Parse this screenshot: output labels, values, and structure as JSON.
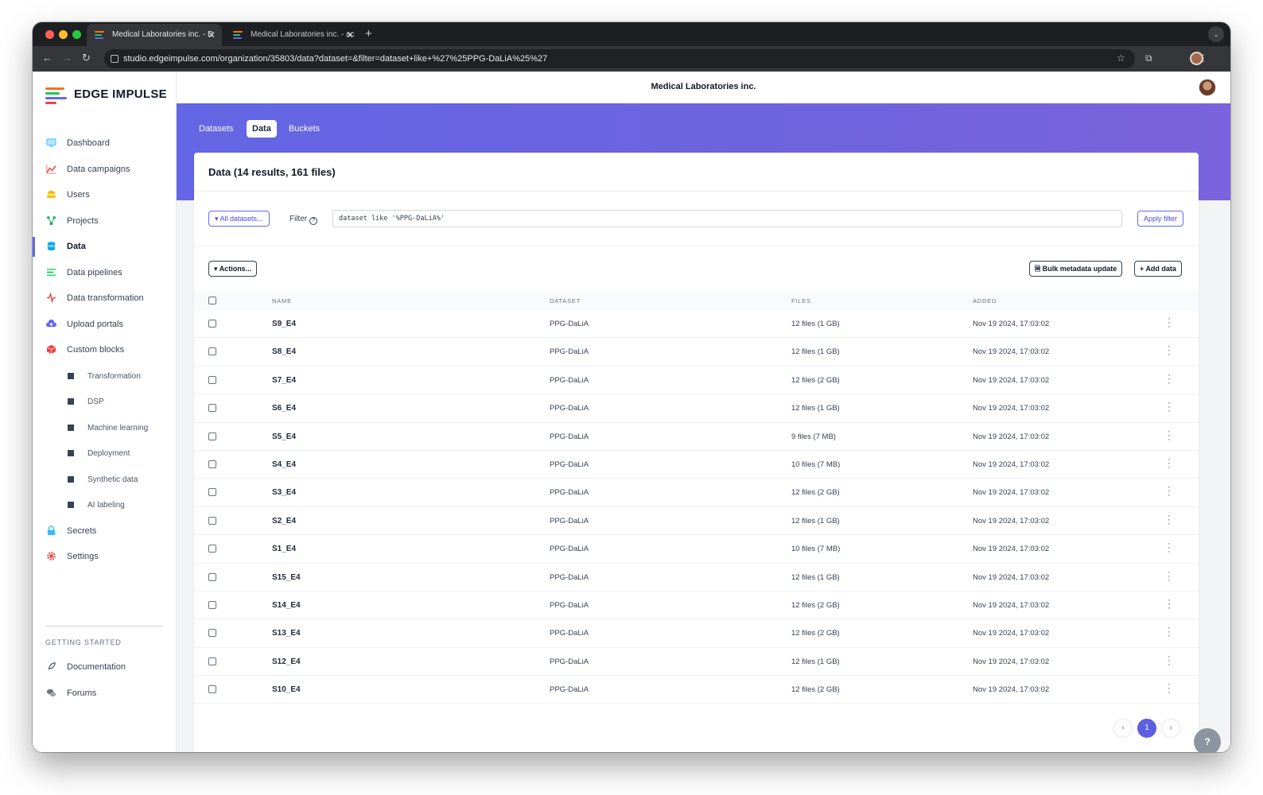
{
  "browser": {
    "tabs": [
      {
        "title": "Medical Laboratories inc. - D",
        "active": true
      },
      {
        "title": "Medical Laboratories inc. - ac",
        "active": false
      }
    ],
    "url": "studio.edgeimpulse.com/organization/35803/data?dataset=&filter=dataset+like+%27%25PPG-DaLiA%25%27"
  },
  "logo": {
    "text": "EDGE IMPULSE"
  },
  "sidebar": {
    "items": [
      {
        "label": "Dashboard",
        "icon": "monitor-icon"
      },
      {
        "label": "Data campaigns",
        "icon": "chart-line-icon"
      },
      {
        "label": "Users",
        "icon": "users-icon"
      },
      {
        "label": "Projects",
        "icon": "project-tree-icon"
      },
      {
        "label": "Data",
        "icon": "database-icon",
        "active": true
      },
      {
        "label": "Data pipelines",
        "icon": "list-icon"
      },
      {
        "label": "Data transformation",
        "icon": "pulse-icon"
      },
      {
        "label": "Upload portals",
        "icon": "cloud-upload-icon"
      },
      {
        "label": "Custom blocks",
        "icon": "cube-icon"
      }
    ],
    "sub_items": [
      "Transformation",
      "DSP",
      "Machine learning",
      "Deployment",
      "Synthetic data",
      "AI labeling"
    ],
    "bottom_items": [
      {
        "label": "Secrets",
        "icon": "lock-icon"
      },
      {
        "label": "Settings",
        "icon": "gear-icon"
      }
    ],
    "getting_started": {
      "heading": "GETTING STARTED",
      "items": [
        {
          "label": "Documentation",
          "icon": "rocket-icon"
        },
        {
          "label": "Forums",
          "icon": "chat-icon"
        }
      ]
    }
  },
  "header": {
    "org_title": "Medical Laboratories inc."
  },
  "subtabs": [
    "Datasets",
    "Data",
    "Buckets"
  ],
  "card": {
    "title": "Data (14 results, 161 files)",
    "all_datasets_label": "All datasets...",
    "filter_label": "Filter",
    "filter_value": "dataset like '%PPG-DaLiA%'",
    "apply_label": "Apply filter",
    "actions_label": "Actions...",
    "bulk_label": "Bulk metadata update",
    "add_label": "Add data"
  },
  "table": {
    "headers": {
      "name": "NAME",
      "dataset": "DATASET",
      "files": "FILES",
      "added": "ADDED"
    },
    "rows": [
      {
        "name": "S9_E4",
        "dataset": "PPG-DaLiA",
        "files": "12 files (1 GB)",
        "added": "Nov 19 2024, 17:03:02"
      },
      {
        "name": "S8_E4",
        "dataset": "PPG-DaLiA",
        "files": "12 files (1 GB)",
        "added": "Nov 19 2024, 17:03:02"
      },
      {
        "name": "S7_E4",
        "dataset": "PPG-DaLiA",
        "files": "12 files (2 GB)",
        "added": "Nov 19 2024, 17:03:02"
      },
      {
        "name": "S6_E4",
        "dataset": "PPG-DaLiA",
        "files": "12 files (1 GB)",
        "added": "Nov 19 2024, 17:03:02"
      },
      {
        "name": "S5_E4",
        "dataset": "PPG-DaLiA",
        "files": "9 files (7 MB)",
        "added": "Nov 19 2024, 17:03:02"
      },
      {
        "name": "S4_E4",
        "dataset": "PPG-DaLiA",
        "files": "10 files (7 MB)",
        "added": "Nov 19 2024, 17:03:02"
      },
      {
        "name": "S3_E4",
        "dataset": "PPG-DaLiA",
        "files": "12 files (2 GB)",
        "added": "Nov 19 2024, 17:03:02"
      },
      {
        "name": "S2_E4",
        "dataset": "PPG-DaLiA",
        "files": "12 files (1 GB)",
        "added": "Nov 19 2024, 17:03:02"
      },
      {
        "name": "S1_E4",
        "dataset": "PPG-DaLiA",
        "files": "10 files (7 MB)",
        "added": "Nov 19 2024, 17:03:02"
      },
      {
        "name": "S15_E4",
        "dataset": "PPG-DaLiA",
        "files": "12 files (1 GB)",
        "added": "Nov 19 2024, 17:03:02"
      },
      {
        "name": "S14_E4",
        "dataset": "PPG-DaLiA",
        "files": "12 files (2 GB)",
        "added": "Nov 19 2024, 17:03:02"
      },
      {
        "name": "S13_E4",
        "dataset": "PPG-DaLiA",
        "files": "12 files (2 GB)",
        "added": "Nov 19 2024, 17:03:02"
      },
      {
        "name": "S12_E4",
        "dataset": "PPG-DaLiA",
        "files": "12 files (1 GB)",
        "added": "Nov 19 2024, 17:03:02"
      },
      {
        "name": "S10_E4",
        "dataset": "PPG-DaLiA",
        "files": "12 files (2 GB)",
        "added": "Nov 19 2024, 17:03:02"
      }
    ]
  },
  "pagination": {
    "current": "1"
  },
  "help": {
    "label": "?"
  },
  "colors": {
    "accent": "#6366f1",
    "hero_start": "#6366e5",
    "hero_end": "#7a63dc"
  }
}
